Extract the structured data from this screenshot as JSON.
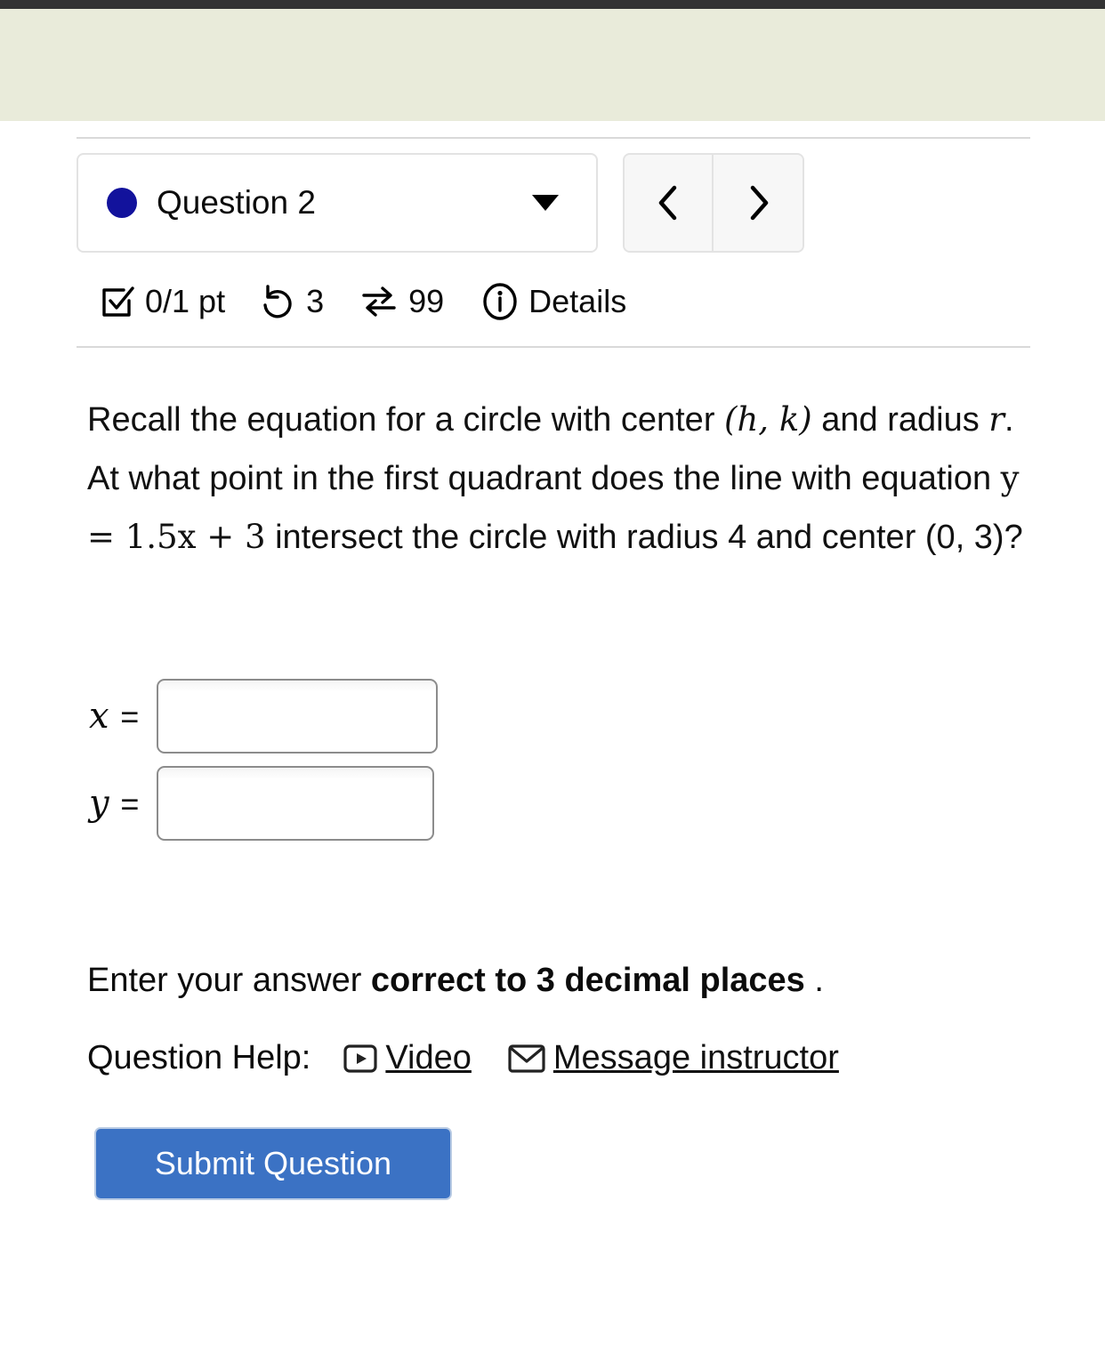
{
  "top": {
    "banner_color": "#e9ebda",
    "bar_color": "#333333"
  },
  "question_selector": {
    "dot_color": "#12129c",
    "label": "Question 2",
    "caret_icon": "chevron-down-icon"
  },
  "navigation": {
    "prev_icon": "chevron-left-icon",
    "next_icon": "chevron-right-icon"
  },
  "status": {
    "points_icon": "checkbox-checked-icon",
    "points": "0/1 pt",
    "tries_icon": "undo-arrow-icon",
    "tries": "3",
    "retry_icon": "swap-arrows-icon",
    "retries": "99",
    "info_icon": "info-circle-icon",
    "details_label": "Details"
  },
  "question": {
    "text_part_1": "Recall the equation for a circle with center ",
    "center_expr": "(h, k)",
    "text_part_2": " and radius ",
    "radius_var": "r",
    "text_part_3": ". At what point in the first quadrant does the line with equation ",
    "line_equation": "y = 1.5x + 3",
    "text_part_4": " intersect the circle with radius 4 and center (0, 3)?"
  },
  "answers": {
    "x_label": "x",
    "y_label": "y",
    "equals": "=",
    "x_value": "",
    "y_value": "",
    "x_placeholder": "",
    "y_placeholder": ""
  },
  "note": {
    "prefix": "Enter your answer ",
    "emphasis": "correct to 3 decimal places",
    "suffix": " ."
  },
  "help": {
    "label": "Question Help:",
    "video_icon": "video-play-icon",
    "video_label": "Video",
    "message_icon": "envelope-icon",
    "message_label": "Message instructor"
  },
  "submit": {
    "label": "Submit Question",
    "color": "#3b72c4"
  }
}
